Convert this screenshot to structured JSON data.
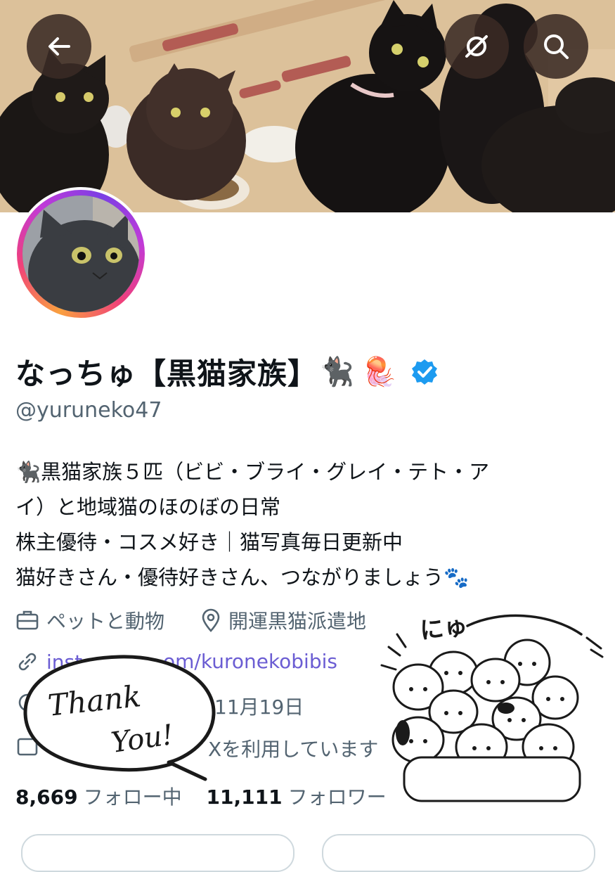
{
  "header": {
    "back_icon": "arrow-left-icon",
    "grok_icon": "grok-icon",
    "search_icon": "search-icon"
  },
  "profile": {
    "display_name": "なっちゅ【黒猫家族】",
    "display_name_emojis": [
      "🐈‍⬛",
      "🪼"
    ],
    "verified_badge": "verified-badge-icon",
    "handle": "@yuruneko47",
    "bio_lines": [
      "🐈‍⬛黒猫家族５匹（ビビ・ブライ・グレイ・テト・ア",
      "イ）と地域猫のほのぼの日常",
      "株主優待・コスメ好き｜猫写真毎日更新中",
      "猫好きさん・優待好きさん、つながりましょう🐾"
    ],
    "category": "ペットと動物",
    "location": "開運黒猫派遣地",
    "link_start": "inst",
    "link_end": "om/kuronekobibis",
    "joined": "11月19日",
    "x_usage": "Xを利用しています",
    "following_count": "8,669",
    "following_label": "フォロー中",
    "followers_count": "11,111",
    "followers_label": "フォロワー"
  },
  "stickers": {
    "thank_line1": "Thank",
    "thank_line2": "You!",
    "nyu_text": "にゅ"
  },
  "colors": {
    "accent_link": "#6b5dd3",
    "verified": "#1d9bf0",
    "secondary_text": "#536471",
    "button_bg": "#3a2a24"
  }
}
